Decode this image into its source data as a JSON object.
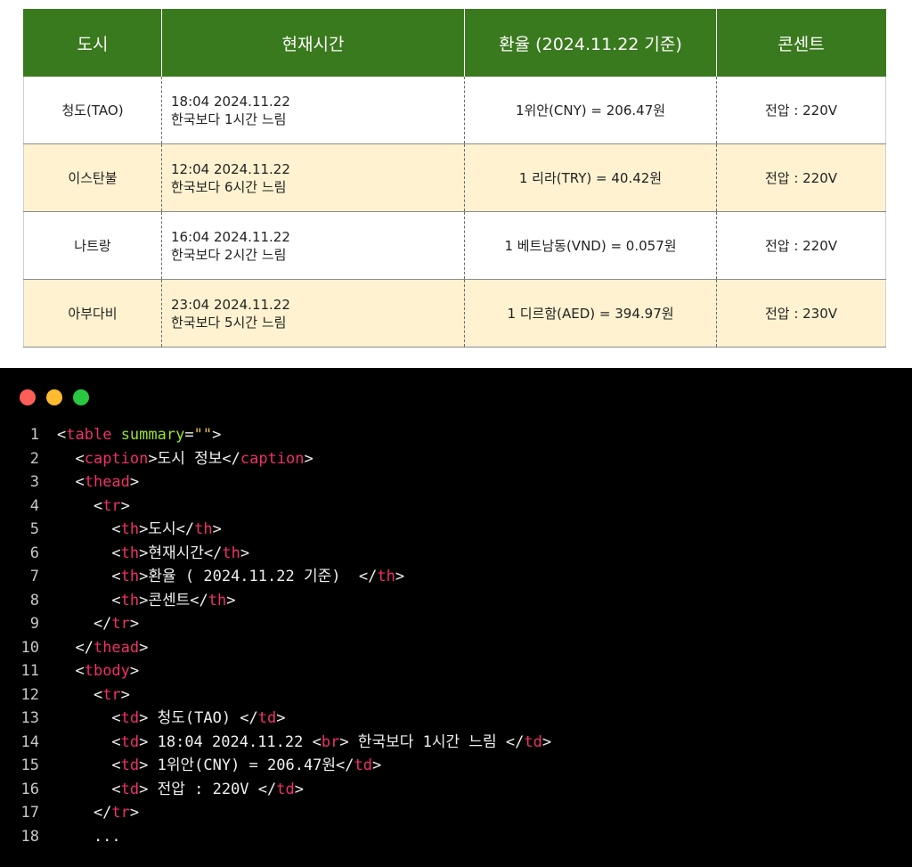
{
  "table": {
    "headers": [
      "도시",
      "현재시간",
      "환율 (2024.11.22 기준)",
      "콘센트"
    ],
    "rows": [
      {
        "city": "청도(TAO)",
        "time": "18:04 2024.11.22",
        "diff": "한국보다 1시간 느림",
        "rate": "1위안(CNY) = 206.47원",
        "plug": "전압 : 220V"
      },
      {
        "city": "이스탄불",
        "time": "12:04 2024.11.22",
        "diff": "한국보다 6시간 느림",
        "rate": "1 리라(TRY) = 40.42원",
        "plug": "전압 : 220V"
      },
      {
        "city": "나트랑",
        "time": "16:04 2024.11.22",
        "diff": "한국보다 2시간 느림",
        "rate": "1 베트남동(VND) = 0.057원",
        "plug": "전압 : 220V"
      },
      {
        "city": "아부다비",
        "time": "23:04 2024.11.22",
        "diff": "한국보다 5시간 느림",
        "rate": "1 디르함(AED) = 394.97원",
        "plug": "전압 : 230V"
      }
    ]
  },
  "colors": {
    "header_bg": "#3a7a1e",
    "alt_row_bg": "#fef2d0",
    "editor_bg": "#000000",
    "tag": "#f0306a",
    "attr": "#9be22a"
  },
  "editor": {
    "window_controls": [
      "close-dot",
      "minimize-dot",
      "maximize-dot"
    ],
    "lines": [
      {
        "n": "1",
        "tokens": [
          [
            "tx",
            "<"
          ],
          [
            "tg",
            "table"
          ],
          [
            "tx",
            " "
          ],
          [
            "at",
            "summary"
          ],
          [
            "tx",
            "="
          ],
          [
            "st",
            "\"\""
          ],
          [
            "tx",
            ">"
          ]
        ]
      },
      {
        "n": "2",
        "tokens": [
          [
            "tx",
            "  <"
          ],
          [
            "tg",
            "caption"
          ],
          [
            "tx",
            ">도시 정보</"
          ],
          [
            "tg",
            "caption"
          ],
          [
            "tx",
            ">"
          ]
        ]
      },
      {
        "n": "3",
        "tokens": [
          [
            "tx",
            "  <"
          ],
          [
            "tg",
            "thead"
          ],
          [
            "tx",
            ">"
          ]
        ]
      },
      {
        "n": "4",
        "tokens": [
          [
            "tx",
            "    <"
          ],
          [
            "tg",
            "tr"
          ],
          [
            "tx",
            ">"
          ]
        ]
      },
      {
        "n": "5",
        "tokens": [
          [
            "tx",
            "      <"
          ],
          [
            "tg",
            "th"
          ],
          [
            "tx",
            ">도시</"
          ],
          [
            "tg",
            "th"
          ],
          [
            "tx",
            ">"
          ]
        ]
      },
      {
        "n": "6",
        "tokens": [
          [
            "tx",
            "      <"
          ],
          [
            "tg",
            "th"
          ],
          [
            "tx",
            ">현재시간</"
          ],
          [
            "tg",
            "th"
          ],
          [
            "tx",
            ">"
          ]
        ]
      },
      {
        "n": "7",
        "tokens": [
          [
            "tx",
            "      <"
          ],
          [
            "tg",
            "th"
          ],
          [
            "tx",
            ">환율 ( 2024.11.22 기준)  </"
          ],
          [
            "tg",
            "th"
          ],
          [
            "tx",
            ">"
          ]
        ]
      },
      {
        "n": "8",
        "tokens": [
          [
            "tx",
            "      <"
          ],
          [
            "tg",
            "th"
          ],
          [
            "tx",
            ">콘센트</"
          ],
          [
            "tg",
            "th"
          ],
          [
            "tx",
            ">"
          ]
        ]
      },
      {
        "n": "9",
        "tokens": [
          [
            "tx",
            "    </"
          ],
          [
            "tg",
            "tr"
          ],
          [
            "tx",
            ">"
          ]
        ]
      },
      {
        "n": "10",
        "tokens": [
          [
            "tx",
            "  </"
          ],
          [
            "tg",
            "thead"
          ],
          [
            "tx",
            ">"
          ]
        ]
      },
      {
        "n": "11",
        "tokens": [
          [
            "tx",
            "  <"
          ],
          [
            "tg",
            "tbody"
          ],
          [
            "tx",
            ">"
          ]
        ]
      },
      {
        "n": "12",
        "tokens": [
          [
            "tx",
            "    <"
          ],
          [
            "tg",
            "tr"
          ],
          [
            "tx",
            ">"
          ]
        ]
      },
      {
        "n": "13",
        "tokens": [
          [
            "tx",
            "      <"
          ],
          [
            "tg",
            "td"
          ],
          [
            "tx",
            "> 청도(TAO) </"
          ],
          [
            "tg",
            "td"
          ],
          [
            "tx",
            ">"
          ]
        ]
      },
      {
        "n": "14",
        "tokens": [
          [
            "tx",
            "      <"
          ],
          [
            "tg",
            "td"
          ],
          [
            "tx",
            "> 18:04 2024.11.22 <"
          ],
          [
            "tg",
            "br"
          ],
          [
            "tx",
            "> 한국보다 1시간 느림 </"
          ],
          [
            "tg",
            "td"
          ],
          [
            "tx",
            ">"
          ]
        ]
      },
      {
        "n": "15",
        "tokens": [
          [
            "tx",
            "      <"
          ],
          [
            "tg",
            "td"
          ],
          [
            "tx",
            "> 1위안(CNY) = 206.47원</"
          ],
          [
            "tg",
            "td"
          ],
          [
            "tx",
            ">"
          ]
        ]
      },
      {
        "n": "16",
        "tokens": [
          [
            "tx",
            "      <"
          ],
          [
            "tg",
            "td"
          ],
          [
            "tx",
            "> 전압 : 220V </"
          ],
          [
            "tg",
            "td"
          ],
          [
            "tx",
            ">"
          ]
        ]
      },
      {
        "n": "17",
        "tokens": [
          [
            "tx",
            "    </"
          ],
          [
            "tg",
            "tr"
          ],
          [
            "tx",
            ">"
          ]
        ]
      },
      {
        "n": "18",
        "tokens": [
          [
            "tx",
            "    ..."
          ]
        ]
      }
    ]
  }
}
